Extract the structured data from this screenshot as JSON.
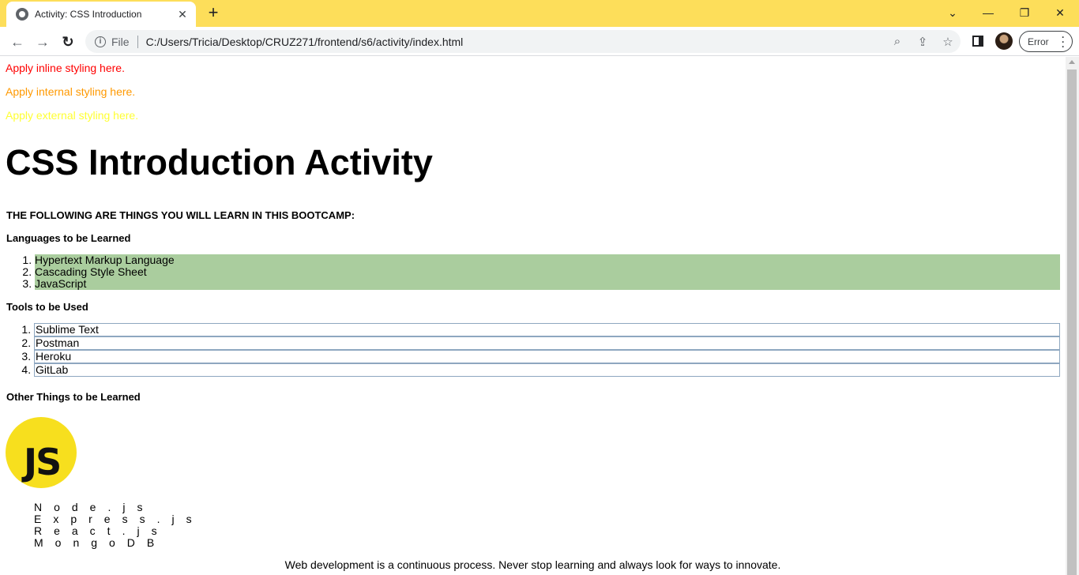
{
  "browser": {
    "tab_title": "Activity: CSS Introduction",
    "tab_close": "✕",
    "new_tab": "+",
    "scheme": "File",
    "url": "C:/Users/Tricia/Desktop/CRUZ271/frontend/s6/activity/index.html",
    "error_label": "Error",
    "accent_color": "#fdde5a",
    "window_controls": {
      "dropdown": "⌄",
      "minimize": "—",
      "restore": "❐",
      "close": "✕"
    },
    "nav": {
      "back": "←",
      "forward": "→",
      "reload": "↻"
    },
    "omnibox_icons": {
      "zoom": "⌕",
      "share": "⇪",
      "star": "☆"
    }
  },
  "page": {
    "inline_text": "Apply inline styling here.",
    "internal_text": "Apply internal styling here.",
    "external_text": "Apply external styling here.",
    "title": "CSS Introduction Activity",
    "things_heading": "THE FOLLOWING ARE THINGS YOU WILL LEARN IN THIS BOOTCAMP:",
    "languages_heading": "Languages to be Learned",
    "languages": [
      "Hypertext Markup Language",
      "Cascading Style Sheet",
      "JavaScript"
    ],
    "tools_heading": "Tools to be Used",
    "tools": [
      "Sublime Text",
      "Postman",
      "Heroku",
      "GitLab"
    ],
    "other_heading": "Other Things to be Learned",
    "logo_text": "JS",
    "other": [
      "Node.js",
      "Express.js",
      "React.js",
      "MongoDB"
    ],
    "footer": "Web development is a continuous process. Never stop learning and always look for ways to innovate.",
    "colors": {
      "inline": "#ff0000",
      "internal": "#ff9900",
      "external": "#ffff33",
      "languages_bg": "#aacd9e",
      "tools_border": "#8ea7c0",
      "logo_bg": "#f7df1e"
    }
  }
}
